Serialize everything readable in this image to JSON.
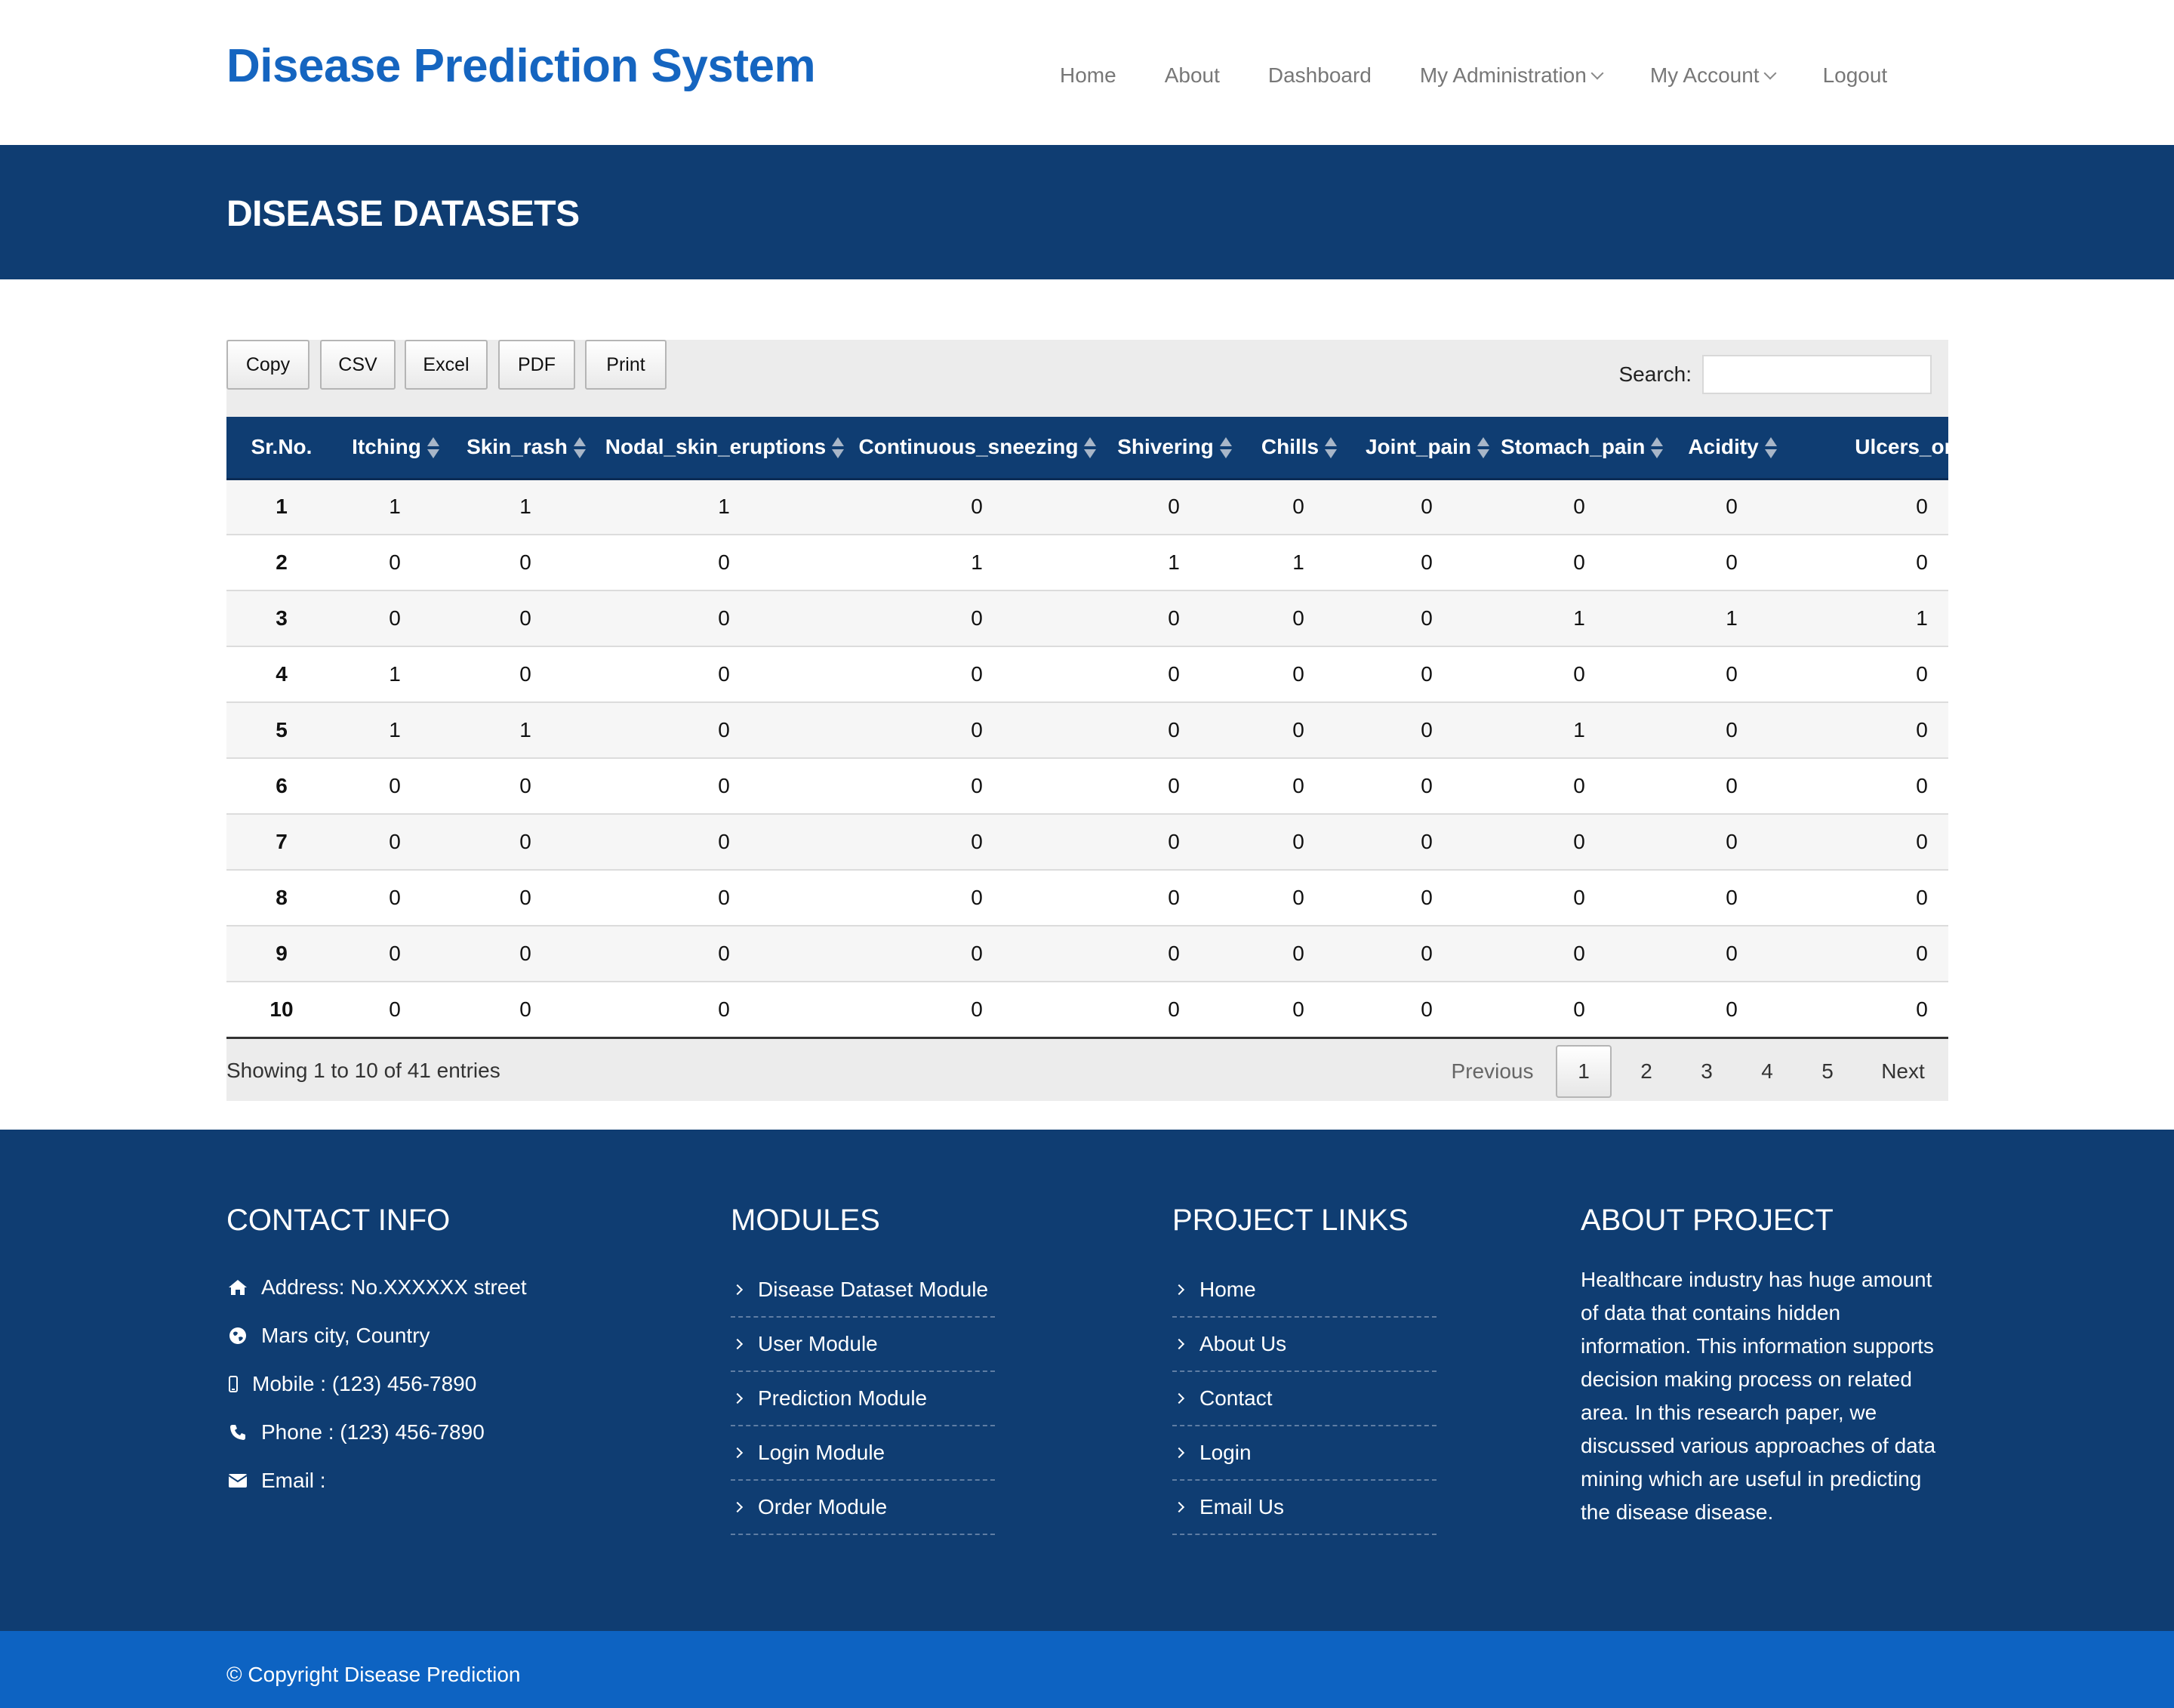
{
  "header": {
    "brand": "Disease Prediction System",
    "nav": [
      {
        "label": "Home",
        "dropdown": false
      },
      {
        "label": "About",
        "dropdown": false
      },
      {
        "label": "Dashboard",
        "dropdown": false
      },
      {
        "label": "My Administration",
        "dropdown": true
      },
      {
        "label": "My Account",
        "dropdown": true
      },
      {
        "label": "Logout",
        "dropdown": false
      }
    ]
  },
  "page_title": "DISEASE DATASETS",
  "toolbar": {
    "buttons": [
      "Copy",
      "CSV",
      "Excel",
      "PDF",
      "Print"
    ],
    "search_label": "Search:",
    "search_value": ""
  },
  "table": {
    "columns": [
      "Sr.No.",
      "Itching",
      "Skin_rash",
      "Nodal_skin_eruptions",
      "Continuous_sneezing",
      "Shivering",
      "Chills",
      "Joint_pain",
      "Stomach_pain",
      "Acidity",
      "Ulcers_on_to"
    ],
    "rows": [
      [
        "1",
        "1",
        "1",
        "1",
        "0",
        "0",
        "0",
        "0",
        "0",
        "0",
        "0"
      ],
      [
        "2",
        "0",
        "0",
        "0",
        "1",
        "1",
        "1",
        "0",
        "0",
        "0",
        "0"
      ],
      [
        "3",
        "0",
        "0",
        "0",
        "0",
        "0",
        "0",
        "0",
        "1",
        "1",
        "1"
      ],
      [
        "4",
        "1",
        "0",
        "0",
        "0",
        "0",
        "0",
        "0",
        "0",
        "0",
        "0"
      ],
      [
        "5",
        "1",
        "1",
        "0",
        "0",
        "0",
        "0",
        "0",
        "1",
        "0",
        "0"
      ],
      [
        "6",
        "0",
        "0",
        "0",
        "0",
        "0",
        "0",
        "0",
        "0",
        "0",
        "0"
      ],
      [
        "7",
        "0",
        "0",
        "0",
        "0",
        "0",
        "0",
        "0",
        "0",
        "0",
        "0"
      ],
      [
        "8",
        "0",
        "0",
        "0",
        "0",
        "0",
        "0",
        "0",
        "0",
        "0",
        "0"
      ],
      [
        "9",
        "0",
        "0",
        "0",
        "0",
        "0",
        "0",
        "0",
        "0",
        "0",
        "0"
      ],
      [
        "10",
        "0",
        "0",
        "0",
        "0",
        "0",
        "0",
        "0",
        "0",
        "0",
        "0"
      ]
    ],
    "info": "Showing 1 to 10 of 41 entries",
    "pagination": {
      "previous": "Previous",
      "pages": [
        "1",
        "2",
        "3",
        "4",
        "5"
      ],
      "active": "1",
      "next": "Next"
    }
  },
  "footer": {
    "contact": {
      "heading": "CONTACT INFO",
      "items": [
        {
          "icon": "home-icon",
          "text": "Address: No.XXXXXX street"
        },
        {
          "icon": "globe-icon",
          "text": "Mars city, Country"
        },
        {
          "icon": "mobile-icon",
          "text": "Mobile : (123) 456-7890"
        },
        {
          "icon": "phone-icon",
          "text": "Phone : (123) 456-7890"
        },
        {
          "icon": "envelope-icon",
          "text": "Email :"
        }
      ]
    },
    "modules": {
      "heading": "MODULES",
      "items": [
        "Disease Dataset Module",
        "User Module",
        "Prediction Module",
        "Login Module",
        "Order Module"
      ]
    },
    "project_links": {
      "heading": "PROJECT LINKS",
      "items": [
        "Home",
        "About Us",
        "Contact",
        "Login",
        "Email Us"
      ]
    },
    "about": {
      "heading": "ABOUT PROJECT",
      "text": "Healthcare industry has huge amount of data that contains hidden information. This information supports decision making process on related area. In this research paper, we discussed various approaches of data mining which are useful in predicting the disease disease."
    },
    "copyright": "© Copyright Disease Prediction"
  },
  "colors": {
    "brand_blue": "#1565c0",
    "navy": "#0f3d72",
    "copyright_bar": "#0d63c2"
  }
}
